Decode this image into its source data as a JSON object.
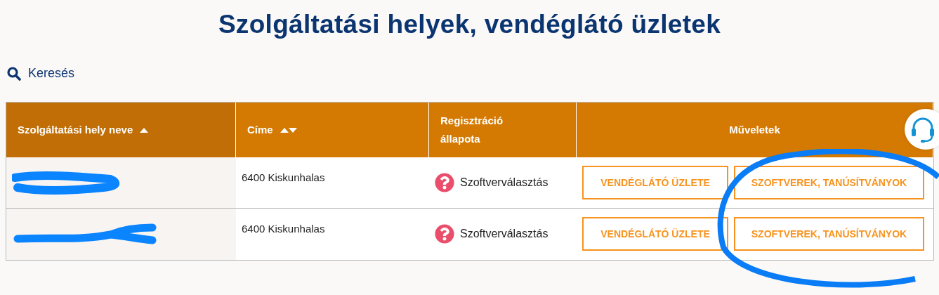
{
  "title": "Szolgáltatási helyek, vendéglátó üzletek",
  "search": {
    "label": "Keresés"
  },
  "table": {
    "columns": [
      {
        "label": "Szolgáltatási hely neve",
        "sortable": true,
        "sorted": true
      },
      {
        "label": "Címe",
        "sortable": true,
        "sorted": false
      },
      {
        "label": "Regisztráció állapota",
        "sortable": false,
        "sorted": false
      },
      {
        "label": "Műveletek",
        "sortable": false,
        "sorted": false
      }
    ],
    "rows": [
      {
        "address": "6400 Kiskunhalas",
        "status": "Szoftverválasztás",
        "actions": [
          "VENDÉGLÁTÓ ÜZLETE",
          "SZOFTVEREK, TANÚSÍTVÁNYOK"
        ]
      },
      {
        "address": "6400 Kiskunhalas",
        "status": "Szoftverválasztás",
        "actions": [
          "VENDÉGLÁTÓ ÜZLETE",
          "SZOFTVEREK, TANÚSÍTVÁNYOK"
        ]
      }
    ]
  }
}
